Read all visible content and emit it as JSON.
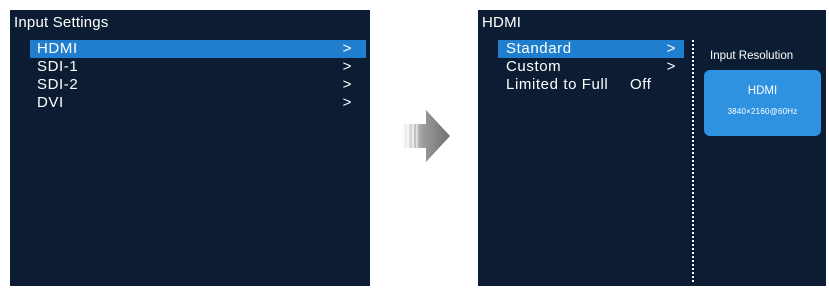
{
  "left_screen": {
    "title": "Input Settings",
    "items": [
      {
        "label": "HDMI",
        "chevron": ">"
      },
      {
        "label": "SDI-1",
        "chevron": ">"
      },
      {
        "label": "SDI-2",
        "chevron": ">"
      },
      {
        "label": "DVI",
        "chevron": ">"
      }
    ],
    "selected_index": 0
  },
  "arrow": {
    "icon": "arrow-right-icon"
  },
  "right_screen": {
    "title": "HDMI",
    "items": [
      {
        "label": "Standard",
        "chevron": ">"
      },
      {
        "label": "Custom",
        "chevron": ">"
      },
      {
        "label": "Limited to Full",
        "value": "Off"
      }
    ],
    "selected_index": 0,
    "input_resolution": {
      "label": "Input Resolution",
      "source": "HDMI",
      "format": "3840×2160@60Hz"
    }
  },
  "colors": {
    "screen_background": "#0b1c33",
    "selection": "#1f7fce",
    "resolution_card": "#2e92e0",
    "text": "#ffffff"
  }
}
